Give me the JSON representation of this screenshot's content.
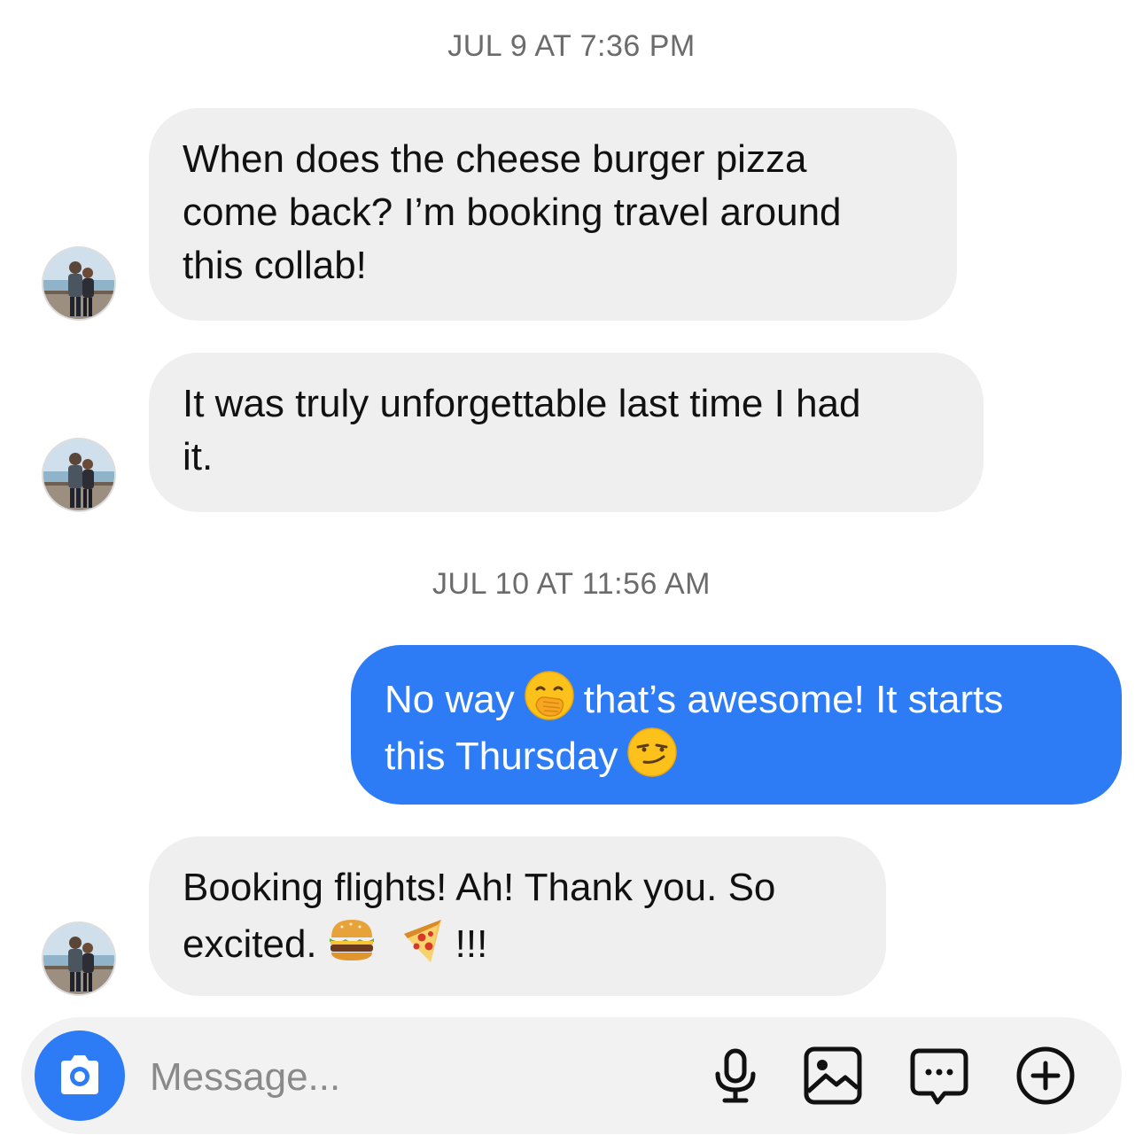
{
  "timestamps": [
    "JUL 9 AT 7:36 PM",
    "JUL 10 AT 11:56 AM"
  ],
  "messages": [
    {
      "line1": "When does the cheese burger pizza",
      "line2": "come back? I’m booking travel around",
      "line3": "this collab!"
    },
    {
      "line1": "It was truly unforgettable last time I had",
      "line2": "it."
    },
    {
      "line1a": "No way",
      "line1b": "that’s awesome! It starts",
      "line2": "this Thursday"
    },
    {
      "line1": "Booking flights! Ah! Thank you. So",
      "line2a": "excited.",
      "line2b": "!!!"
    }
  ],
  "emojis": {
    "hand_over_mouth": "face-with-hand-over-mouth",
    "smirk": "smirking-face",
    "burger": "hamburger",
    "pizza": "pizza"
  },
  "composer": {
    "placeholder": "Message..."
  },
  "colors": {
    "outgoing_bubble": "#2d7cf6",
    "incoming_bubble": "#efefef",
    "timestamp": "#6b6b6b",
    "accent": "#2d7cf6"
  }
}
